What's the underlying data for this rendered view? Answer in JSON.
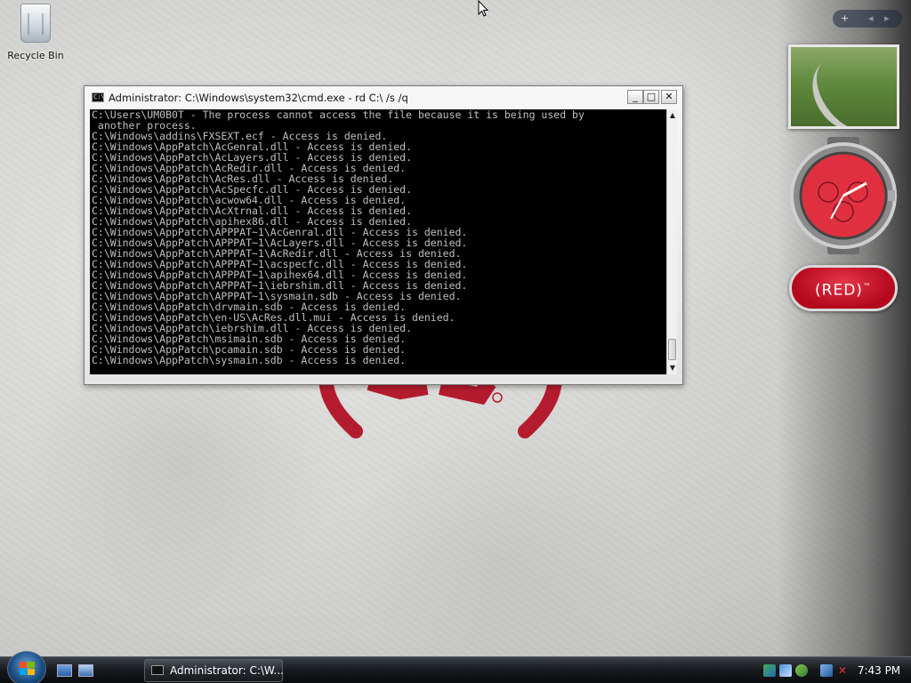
{
  "desktop": {
    "recycle_bin_label": "Recycle Bin",
    "background_logo": "(RED)",
    "accent_red": "#c3132b"
  },
  "cmd_window": {
    "title": "Administrator: C:\\Windows\\system32\\cmd.exe - rd  C:\\ /s /q",
    "console_lines": [
      "C:\\Users\\UM0B0T - The process cannot access the file because it is being used by",
      " another process.",
      "C:\\Windows\\addins\\FXSEXT.ecf - Access is denied.",
      "C:\\Windows\\AppPatch\\AcGenral.dll - Access is denied.",
      "C:\\Windows\\AppPatch\\AcLayers.dll - Access is denied.",
      "C:\\Windows\\AppPatch\\AcRedir.dll - Access is denied.",
      "C:\\Windows\\AppPatch\\AcRes.dll - Access is denied.",
      "C:\\Windows\\AppPatch\\AcSpecfc.dll - Access is denied.",
      "C:\\Windows\\AppPatch\\acwow64.dll - Access is denied.",
      "C:\\Windows\\AppPatch\\AcXtrnal.dll - Access is denied.",
      "C:\\Windows\\AppPatch\\apihex86.dll - Access is denied.",
      "C:\\Windows\\AppPatch\\APPPAT~1\\AcGenral.dll - Access is denied.",
      "C:\\Windows\\AppPatch\\APPPAT~1\\AcLayers.dll - Access is denied.",
      "C:\\Windows\\AppPatch\\APPPAT~1\\AcRedir.dll - Access is denied.",
      "C:\\Windows\\AppPatch\\APPPAT~1\\acspecfc.dll - Access is denied.",
      "C:\\Windows\\AppPatch\\APPPAT~1\\apihex64.dll - Access is denied.",
      "C:\\Windows\\AppPatch\\APPPAT~1\\iebrshim.dll - Access is denied.",
      "C:\\Windows\\AppPatch\\APPPAT~1\\sysmain.sdb - Access is denied.",
      "C:\\Windows\\AppPatch\\drvmain.sdb - Access is denied.",
      "C:\\Windows\\AppPatch\\en-US\\AcRes.dll.mui - Access is denied.",
      "C:\\Windows\\AppPatch\\iebrshim.dll - Access is denied.",
      "C:\\Windows\\AppPatch\\msimain.sdb - Access is denied.",
      "C:\\Windows\\AppPatch\\pcamain.sdb - Access is denied.",
      "C:\\Windows\\AppPatch\\sysmain.sdb - Access is denied."
    ],
    "min_glyph": "_",
    "max_glyph": "□",
    "close_glyph": "✕"
  },
  "sidebar": {
    "add_glyph": "+",
    "prev_glyph": "◂",
    "next_glyph": "▸",
    "red_gadget_label": "(RED)",
    "red_gadget_tm": "™"
  },
  "taskbar": {
    "task_button_label": "Administrator: C:\\W...",
    "clock": "7:43 PM",
    "tray_icons": [
      "network-icon",
      "display-icon",
      "security-icon",
      "connection-icon",
      "volume-muted-icon"
    ]
  }
}
